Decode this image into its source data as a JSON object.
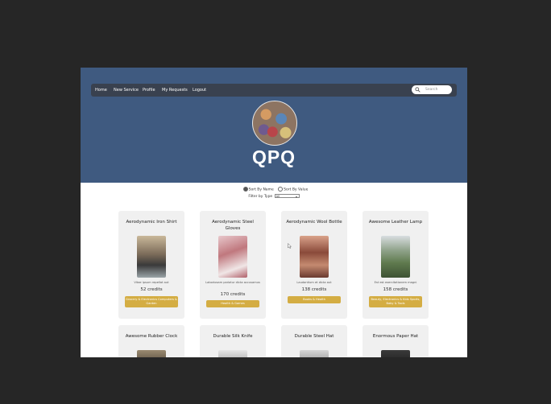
{
  "nav": {
    "links": [
      "Home",
      "New Service",
      "Profile",
      "My Requests",
      "Logout"
    ],
    "search_placeholder": "Search",
    "search_icon": "search-icon"
  },
  "profile": {
    "brand": "QPQ",
    "avatar_icon": "avatar-mosaic"
  },
  "controls": {
    "sort_options": [
      "Sort By Name",
      "Sort By Value"
    ],
    "sort_selected": "Sort By Name",
    "filter_label": "Filter by Type",
    "filter_value": "All"
  },
  "colors": {
    "hero": "#3f5a80",
    "navbar": "#39414f",
    "category_badge": "#d4ad43",
    "card": "#f0f0f0"
  },
  "services": [
    {
      "title": "Aerodynamic Iron Shirt",
      "desc": "Vitae ipsum repellat aut",
      "credits": "52 credits",
      "category": "Grocery & Electronics Computers & Garden"
    },
    {
      "title": "Aerodynamic Steel Gloves",
      "desc": "Laboriosam pariatur dicta accusamus",
      "credits": "170 credits",
      "category": "Health & Games"
    },
    {
      "title": "Aerodynamic Wool Bottle",
      "desc": "Laudantium et dicta aut",
      "credits": "138 credits",
      "category": "Books & Health"
    },
    {
      "title": "Awesome Leather Lamp",
      "desc": "Est est exercitationem magni",
      "credits": "158 credits",
      "category": "Beauty, Electronics & Kids Sports, Baby & Tools"
    },
    {
      "title": "Awesome Rubber Clock"
    },
    {
      "title": "Durable Silk Knife"
    },
    {
      "title": "Durable Steel Hat"
    },
    {
      "title": "Enormous Paper Hat"
    }
  ]
}
